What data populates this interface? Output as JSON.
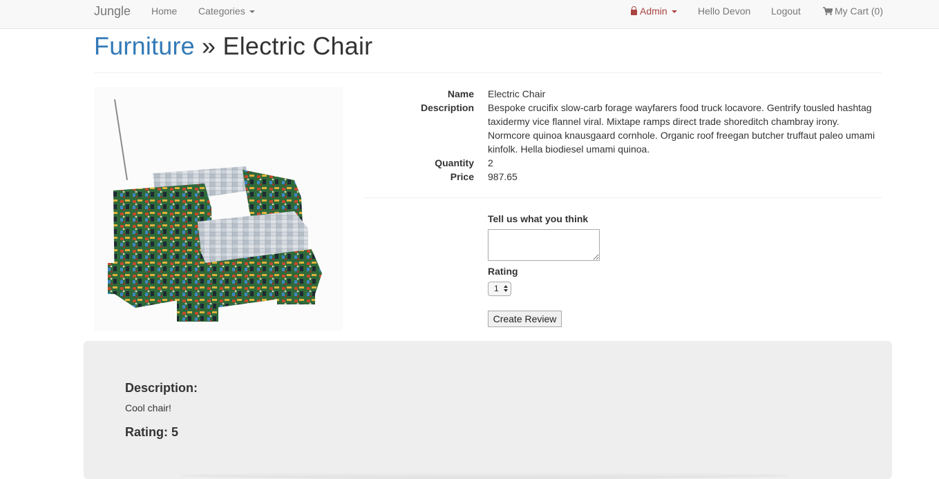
{
  "navbar": {
    "brand": "Jungle",
    "home": "Home",
    "categories": "Categories",
    "admin": "Admin",
    "greeting": "Hello Devon",
    "logout": "Logout",
    "cart": "My Cart (0)",
    "colors": {
      "background": "#f8f8f8",
      "link": "#777777",
      "admin": "#a94442"
    }
  },
  "title": {
    "category": "Furniture",
    "separator": " » ",
    "product": "Electric Chair",
    "colors": {
      "category": "#337ab7"
    }
  },
  "product": {
    "image_icon": "electric-chair-image",
    "labels": {
      "name": "Name",
      "description": "Description",
      "quantity": "Quantity",
      "price": "Price"
    },
    "name": "Electric Chair",
    "description": "Bespoke crucifix slow-carb forage wayfarers food truck locavore. Gentrify tousled hashtag taxidermy vice flannel viral. Mixtape ramps direct trade shoreditch chambray irony. Normcore quinoa knausgaard cornhole. Organic roof freegan butcher truffaut paleo umami kinfolk. Hella biodiesel umami quinoa.",
    "quantity": "2",
    "price": "987.65"
  },
  "review_form": {
    "prompt": "Tell us what you think",
    "textarea_value": "",
    "rating_label": "Rating",
    "rating_selected": "1",
    "submit_label": "Create Review"
  },
  "reviews": [
    {
      "heading": "Description:",
      "text": "Cool chair!",
      "rating_text": "Rating: 5"
    }
  ]
}
